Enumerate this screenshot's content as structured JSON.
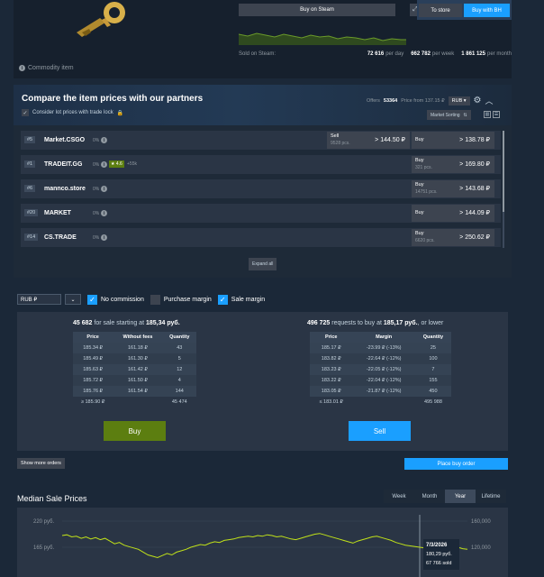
{
  "commodity": {
    "label": "Commodity item"
  },
  "steam": {
    "buy_label": "Buy on Steam",
    "sold_label": "Sold on Steam:",
    "per_day_value": "72 616",
    "per_day_label": "per day",
    "per_week_value": "662 782",
    "per_week_label": "per week",
    "per_month_value": "1 861 125",
    "per_month_label": "per month"
  },
  "bh": {
    "to_store": "To store",
    "buy_label": "Buy with BH"
  },
  "partners": {
    "title": "Compare the item prices with our partners",
    "lot_price": "Consider lot prices with trade lock",
    "offers_label": "Offers",
    "offers_value": "53364",
    "price_from": "Price from 137.15 ₽",
    "currency": "RUB",
    "market_sort": "Market Sorting",
    "expand_all": "Expand all",
    "rows": [
      {
        "rank": "#5",
        "name": "Market.CSGO",
        "pct": "0%",
        "rating": "",
        "reviews": "",
        "sell_label": "Sell",
        "sell_sub": "9528 pcs.",
        "sell_price": "> 144.50 ₽",
        "buy_label": "Buy",
        "buy_sub": "",
        "buy_price": "> 138.78 ₽"
      },
      {
        "rank": "#1",
        "name": "TRADEIT.GG",
        "pct": "0%",
        "rating": "★ 4.6",
        "reviews": "+55k",
        "sell_label": "",
        "sell_sub": "",
        "sell_price": "",
        "buy_label": "Buy",
        "buy_sub": "321 pcs.",
        "buy_price": "> 169.80 ₽"
      },
      {
        "rank": "#6",
        "name": "mannco.store",
        "pct": "0%",
        "rating": "",
        "reviews": "",
        "sell_label": "",
        "sell_sub": "",
        "sell_price": "",
        "buy_label": "Buy",
        "buy_sub": "14751 pcs.",
        "buy_price": "> 143.68 ₽"
      },
      {
        "rank": "#20",
        "name": "MARKET",
        "pct": "0%",
        "rating": "",
        "reviews": "",
        "sell_label": "",
        "sell_sub": "",
        "sell_price": "",
        "buy_label": "Buy",
        "buy_sub": "",
        "buy_price": "> 144.09 ₽"
      },
      {
        "rank": "#14",
        "name": "CS.TRADE",
        "pct": "0%",
        "rating": "",
        "reviews": "",
        "sell_label": "",
        "sell_sub": "",
        "sell_price": "",
        "buy_label": "Buy",
        "buy_sub": "6620 pcs.",
        "buy_price": "> 250.62 ₽"
      }
    ]
  },
  "filters": {
    "currency": "RUB ₽",
    "no_commission": "No commission",
    "purchase_margin": "Purchase margin",
    "sale_margin": "Sale margin"
  },
  "sell_orders": {
    "count": "45 682",
    "text": "for sale starting at",
    "price": "185,34 руб.",
    "headers": [
      "Price",
      "Without fees",
      "Quantity"
    ],
    "rows": [
      [
        "185.34 ₽",
        "161.18 ₽",
        "43"
      ],
      [
        "185.49 ₽",
        "161.30 ₽",
        "5"
      ],
      [
        "185.63 ₽",
        "161.42 ₽",
        "12"
      ],
      [
        "185.72 ₽",
        "161.50 ₽",
        "4"
      ],
      [
        "185.76 ₽",
        "161.54 ₽",
        "144"
      ]
    ],
    "summary": [
      "≥ 185.90 ₽",
      "",
      "45 474"
    ],
    "button": "Buy"
  },
  "buy_orders": {
    "count": "496 725",
    "text": "requests to buy at",
    "price": "185,17 руб.",
    "suffix": "or lower",
    "headers": [
      "Price",
      "Margin",
      "Quantity"
    ],
    "rows": [
      [
        "185.17 ₽",
        "-23.99 ₽ (-13%)",
        "25"
      ],
      [
        "183.82 ₽",
        "-22.64 ₽ (-12%)",
        "100"
      ],
      [
        "183.23 ₽",
        "-22.05 ₽ (-12%)",
        "7"
      ],
      [
        "183.22 ₽",
        "-22.04 ₽ (-12%)",
        "155"
      ],
      [
        "183.05 ₽",
        "-21.87 ₽ (-12%)",
        "450"
      ]
    ],
    "summary": [
      "≤ 183.01 ₽",
      "",
      "495 988"
    ],
    "button": "Sell"
  },
  "actions": {
    "show_more": "Show more orders",
    "place_order": "Place buy order"
  },
  "median": {
    "title": "Median Sale Prices",
    "tabs": [
      "Week",
      "Month",
      "Year",
      "Lifetime"
    ],
    "active_tab": "Year",
    "tooltip_date": "7/3/2026",
    "tooltip_price": "180,29 руб.",
    "tooltip_sold": "67 766 sold"
  },
  "chart_data": {
    "type": "line",
    "title": "Median Sale Prices",
    "y_ticks_left": [
      "220 руб.",
      "165 руб."
    ],
    "y_ticks_right": [
      "160,000",
      "120,000"
    ],
    "y_range": [
      140,
      230
    ],
    "values": [
      200,
      201,
      198,
      199,
      196,
      198,
      195,
      197,
      194,
      196,
      192,
      188,
      190,
      186,
      184,
      182,
      180,
      176,
      172,
      170,
      168,
      171,
      174,
      172,
      176,
      178,
      180,
      183,
      185,
      187,
      186,
      189,
      191,
      190,
      193,
      194,
      195,
      197,
      198,
      199,
      198,
      200,
      199,
      201,
      200,
      198,
      199,
      197,
      195,
      194,
      196,
      198,
      200,
      202,
      203,
      201,
      199,
      197,
      195,
      193,
      191,
      189,
      192,
      194,
      196,
      198,
      199,
      197,
      195,
      193,
      190,
      188,
      186,
      185,
      184,
      183,
      182,
      181,
      180,
      182,
      184,
      186,
      185,
      183,
      181,
      180
    ]
  },
  "colors": {
    "accent": "#1a9fff",
    "buy_green": "#5c7e10",
    "line": "#c1e219",
    "background": "#1b2838"
  }
}
